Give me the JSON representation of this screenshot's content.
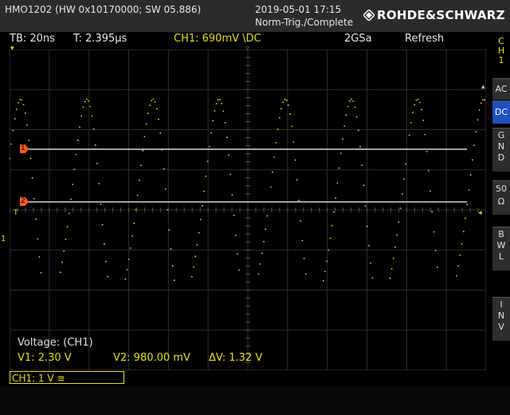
{
  "device": {
    "model_info": "HMO1202 (HW 0x10170000; SW 05.886)",
    "datetime": "2019-05-01 17:15",
    "trigger_status": "Norm-Trig./Complete",
    "brand": "ROHDE&SCHWARZ"
  },
  "status": {
    "timebase": "TB: 20ns",
    "trigger_time": "T: 2.395µs",
    "channel": "CH1: 690mV \\DC",
    "sample_rate": "2GSa",
    "mode": "Refresh"
  },
  "side_menu": {
    "channel_label": [
      "C",
      "H",
      "1"
    ],
    "buttons": [
      {
        "label": "AC",
        "active": false
      },
      {
        "label": "DC",
        "active": true
      },
      {
        "label": "G\nN\nD",
        "active": false
      },
      {
        "label": "50\nΩ",
        "active": false
      },
      {
        "label": "B\nW\nL",
        "active": false
      },
      {
        "label": "I\nN\nV",
        "active": false
      }
    ]
  },
  "cursors": {
    "cursor1_marker": "1",
    "cursor2_marker": "2",
    "trigger_marker": "T",
    "ground_marker": "1"
  },
  "measurement": {
    "title": "Voltage: (CH1)",
    "v1": "V1: 2.30 V",
    "v2": "V2: 980.00 mV",
    "dv": "ΔV: 1.32 V"
  },
  "channel_box": "CH1: 1 V ≅",
  "colors": {
    "trace": "#e8e000",
    "cursor_marker": "#ff5a1e",
    "active_button": "#1f4fc2"
  }
}
